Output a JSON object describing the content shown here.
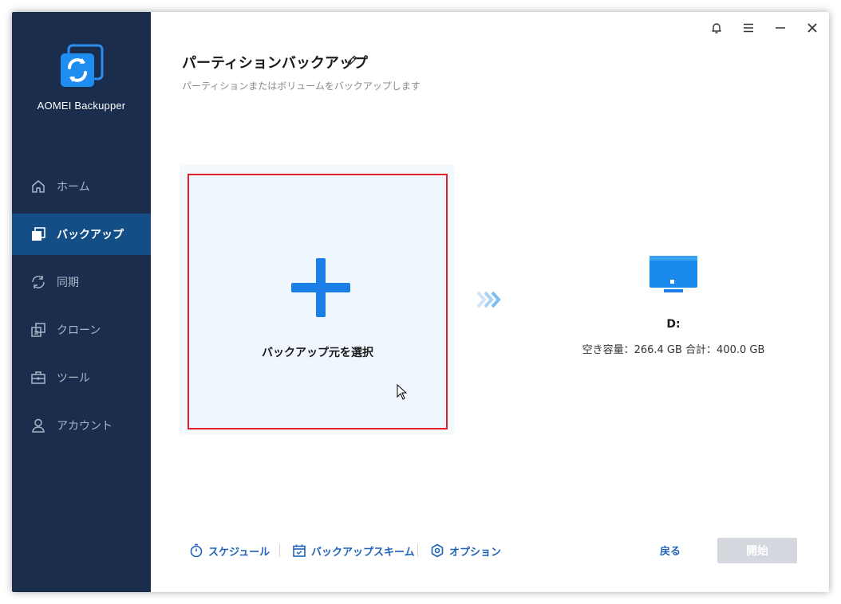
{
  "app": {
    "name": "AOMEI Backupper"
  },
  "sidebar": {
    "items": [
      {
        "label": "ホーム",
        "icon": "home-icon",
        "active": false
      },
      {
        "label": "バックアップ",
        "icon": "backup-icon",
        "active": true
      },
      {
        "label": "同期",
        "icon": "sync-icon",
        "active": false
      },
      {
        "label": "クローン",
        "icon": "clone-icon",
        "active": false
      },
      {
        "label": "ツール",
        "icon": "toolbox-icon",
        "active": false
      },
      {
        "label": "アカウント",
        "icon": "user-icon",
        "active": false
      }
    ]
  },
  "titlebar": {
    "icons": [
      "bell-icon",
      "menu-icon",
      "minimize-icon",
      "close-icon"
    ]
  },
  "page": {
    "title": "パーティションバックアップ",
    "subtitle": "パーティションまたはボリュームをバックアップします"
  },
  "source": {
    "label": "バックアップ元を選択"
  },
  "destination": {
    "name": "D:",
    "capacity": "空き容量：266.4 GB 合計：400.0 GB"
  },
  "footer": {
    "schedule": "スケジュール",
    "scheme": "バックアップスキーム",
    "options": "オプション",
    "back": "戻る",
    "start": "開始"
  },
  "colors": {
    "sidebar_bg": "#1a2d4d",
    "sidebar_active": "#144e86",
    "accent": "#1f62b9",
    "highlight_border": "#e0202a",
    "plus": "#1a7ee6",
    "disabled_button": "#d4d8de"
  }
}
